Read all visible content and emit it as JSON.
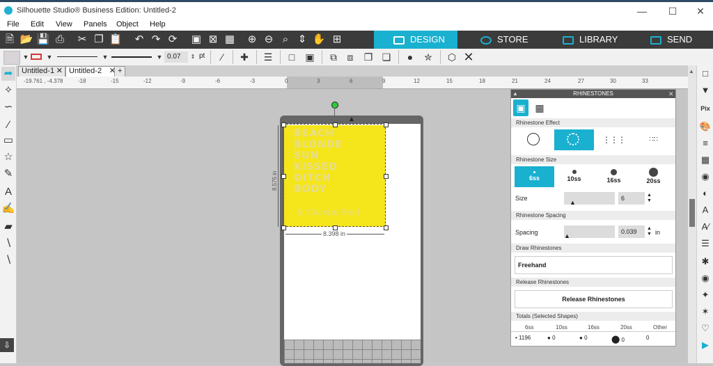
{
  "window": {
    "title": "Silhouette Studio® Business Edition: Untitled-2",
    "min": "—",
    "max": "☐",
    "close": "✕"
  },
  "menu": [
    "File",
    "Edit",
    "View",
    "Panels",
    "Object",
    "Help"
  ],
  "topnav": {
    "design": "DESIGN",
    "store": "STORE",
    "library": "LIBRARY",
    "send": "SEND"
  },
  "toolbar2": {
    "line_width": "0.07",
    "unit": "pt"
  },
  "tabs": [
    {
      "label": "Untitled-1"
    },
    {
      "label": "Untitled-2"
    }
  ],
  "tabs_add": "+",
  "ruler_labels": [
    "-19.761 , -4.378",
    "-18",
    "-15",
    "-12",
    "-9",
    "-6",
    "-3",
    "0",
    "3",
    "6",
    "9",
    "12",
    "15",
    "18",
    "21",
    "24",
    "27",
    "30",
    "33"
  ],
  "design": {
    "lines": [
      "BEACH",
      "BLONDE",
      "SUN",
      "KISSED",
      "DITCH",
      "BODY",
      "& Coastal Soul"
    ],
    "height_label": "8.575 in",
    "width_label": "8.398 in",
    "fill": "#f5e51b",
    "text_color": "#e6dd8e"
  },
  "panel": {
    "title": "RHINESTONES",
    "sections": {
      "effect": "Rhinestone Effect",
      "size": "Rhinestone Size",
      "spacing": "Rhinestone Spacing",
      "draw": "Draw Rhinestones",
      "release": "Release Rhinestones",
      "totals": "Totals (Selected Shapes)"
    },
    "sizes": [
      "6ss",
      "10ss",
      "16ss",
      "20ss"
    ],
    "size_label": "Size",
    "size_value": "6",
    "spacing_label": "Spacing",
    "spacing_value": "0.039",
    "spacing_unit": "in",
    "freehand": "Freehand",
    "release_button": "Release Rhinestones",
    "totals_headers": [
      "6ss",
      "10ss",
      "16ss",
      "20ss",
      "Other"
    ],
    "totals_values": [
      "1196",
      "0",
      "0",
      "0",
      "0"
    ]
  },
  "colors": {
    "accent": "#1ab0cf",
    "toolbar": "#3b3b3b"
  }
}
